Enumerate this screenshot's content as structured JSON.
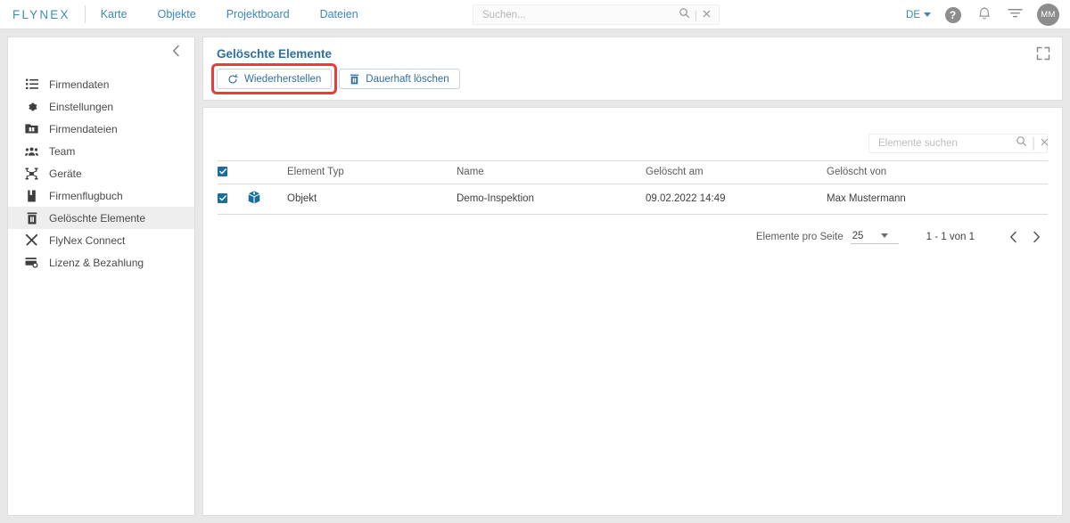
{
  "header": {
    "logo": "FLYNEX",
    "nav": [
      {
        "label": "Karte"
      },
      {
        "label": "Objekte"
      },
      {
        "label": "Projektboard"
      },
      {
        "label": "Dateien"
      }
    ],
    "search": {
      "placeholder": "Suchen...",
      "value": "",
      "search_icon": "search-icon",
      "clear_icon": "close-icon"
    },
    "language": {
      "label": "DE",
      "caret_icon": "chevron-down-icon"
    },
    "help_icon": "help-circle-icon",
    "help_glyph": "?",
    "notifications_icon": "bell-icon",
    "filter_icon": "filter-icon",
    "avatar": {
      "initials": "MM"
    }
  },
  "sidebar": {
    "collapse_icon": "chevron-left-icon",
    "items": [
      {
        "label": "Firmendaten",
        "icon": "list-icon",
        "active": false
      },
      {
        "label": "Einstellungen",
        "icon": "gear-icon",
        "active": false
      },
      {
        "label": "Firmendateien",
        "icon": "folder-icon",
        "active": false
      },
      {
        "label": "Team",
        "icon": "people-icon",
        "active": false
      },
      {
        "label": "Geräte",
        "icon": "drone-icon",
        "active": false
      },
      {
        "label": "Firmenflugbuch",
        "icon": "book-icon",
        "active": false
      },
      {
        "label": "Gelöschte Elemente",
        "icon": "trash-icon",
        "active": true
      },
      {
        "label": "FlyNex Connect",
        "icon": "tools-icon",
        "active": false
      },
      {
        "label": "Lizenz & Bezahlung",
        "icon": "creditcard-icon",
        "active": false
      }
    ]
  },
  "main": {
    "title": "Gelöschte Elemente",
    "expand_icon": "fullscreen-icon",
    "buttons": [
      {
        "label": "Wiederherstellen",
        "icon": "restore-icon",
        "highlighted": true
      },
      {
        "label": "Dauerhaft löschen",
        "icon": "trash-icon",
        "highlighted": false
      }
    ],
    "highlight_color": "#ef3a3a",
    "accent_color": "#2f6f9e",
    "table_search": {
      "placeholder": "Elemente suchen",
      "value": "",
      "search_icon": "search-icon",
      "clear_icon": "close-icon"
    },
    "table": {
      "select_all_checked": true,
      "columns": [
        {
          "key": "check",
          "label": ""
        },
        {
          "key": "icon",
          "label": ""
        },
        {
          "key": "type",
          "label": "Element Typ"
        },
        {
          "key": "name",
          "label": "Name"
        },
        {
          "key": "deleted_at",
          "label": "Gelöscht am"
        },
        {
          "key": "deleted_by",
          "label": "Gelöscht von"
        }
      ],
      "rows": [
        {
          "checked": true,
          "icon": "cube-icon",
          "type": "Objekt",
          "name": "Demo-Inspektion",
          "deleted_at": "09.02.2022 14:49",
          "deleted_by": "Max Mustermann"
        }
      ]
    },
    "pagination": {
      "per_page_label": "Elemente pro Seite",
      "per_page_value": "25",
      "range": "1 - 1 von 1",
      "prev_icon": "chevron-left-icon",
      "next_icon": "chevron-right-icon",
      "prev_glyph": "‹",
      "next_glyph": "›"
    }
  }
}
